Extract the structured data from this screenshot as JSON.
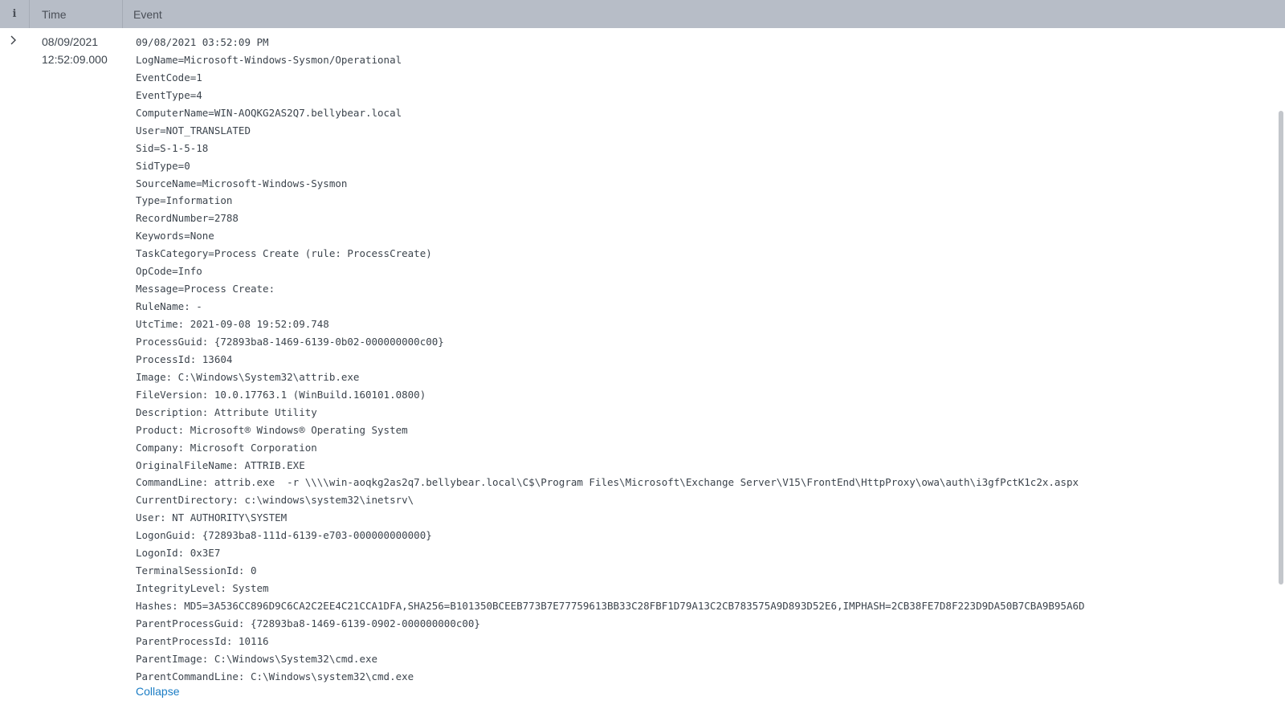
{
  "header": {
    "info_label": "i",
    "time_label": "Time",
    "event_label": "Event"
  },
  "row": {
    "time": {
      "date": "08/09/2021",
      "clock": "12:52:09.000"
    },
    "event_lines": [
      "09/08/2021 03:52:09 PM",
      "LogName=Microsoft-Windows-Sysmon/Operational",
      "EventCode=1",
      "EventType=4",
      "ComputerName=WIN-AOQKG2AS2Q7.bellybear.local",
      "User=NOT_TRANSLATED",
      "Sid=S-1-5-18",
      "SidType=0",
      "SourceName=Microsoft-Windows-Sysmon",
      "Type=Information",
      "RecordNumber=2788",
      "Keywords=None",
      "TaskCategory=Process Create (rule: ProcessCreate)",
      "OpCode=Info",
      "Message=Process Create:",
      "RuleName: -",
      "UtcTime: 2021-09-08 19:52:09.748",
      "ProcessGuid: {72893ba8-1469-6139-0b02-000000000c00}",
      "ProcessId: 13604",
      "Image: C:\\Windows\\System32\\attrib.exe",
      "FileVersion: 10.0.17763.1 (WinBuild.160101.0800)",
      "Description: Attribute Utility",
      "Product: Microsoft® Windows® Operating System",
      "Company: Microsoft Corporation",
      "OriginalFileName: ATTRIB.EXE",
      "CommandLine: attrib.exe  -r \\\\\\\\win-aoqkg2as2q7.bellybear.local\\C$\\Program Files\\Microsoft\\Exchange Server\\V15\\FrontEnd\\HttpProxy\\owa\\auth\\i3gfPctK1c2x.aspx",
      "CurrentDirectory: c:\\windows\\system32\\inetsrv\\",
      "User: NT AUTHORITY\\SYSTEM",
      "LogonGuid: {72893ba8-111d-6139-e703-000000000000}",
      "LogonId: 0x3E7",
      "TerminalSessionId: 0",
      "IntegrityLevel: System",
      "Hashes: MD5=3A536CC896D9C6CA2C2EE4C21CCA1DFA,SHA256=B101350BCEEB773B7E77759613BB33C28FBF1D79A13C2CB783575A9D893D52E6,IMPHASH=2CB38FE7D8F223D9DA50B7CBA9B95A6D",
      "ParentProcessGuid: {72893ba8-1469-6139-0902-000000000c00}",
      "ParentProcessId: 10116",
      "ParentImage: C:\\Windows\\System32\\cmd.exe",
      "ParentCommandLine: C:\\Windows\\system32\\cmd.exe"
    ],
    "collapse_label": "Collapse"
  },
  "icons": {
    "expander": "chevron-right-icon"
  }
}
